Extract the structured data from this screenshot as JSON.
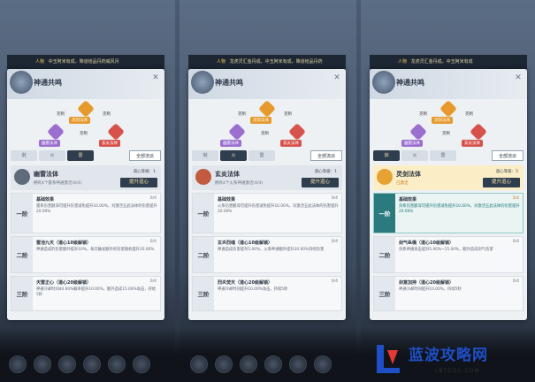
{
  "panels": [
    {
      "top_notice": {
        "tag": "人物",
        "text": "中玉阿米有成，降道结品丹药威风月"
      },
      "title": "神通共鸣",
      "triangle": {
        "top": "灵剑法体",
        "left": "幽雷法体",
        "right": "玄炎法体",
        "rel_left": "克制",
        "rel_right": "克制",
        "rel_bottom": "克制"
      },
      "tabs": [
        "剑",
        "火",
        "雷"
      ],
      "active_tab": 2,
      "all_button": "全部流派",
      "selected": {
        "name": "幽雷法体",
        "sub": "拥有4个雷系神通激活(4/4)",
        "level_label": "道心等级：1",
        "promote": "提升道心"
      },
      "tiers": [
        {
          "badge": "一阶",
          "title": "基础效果",
          "count": "0/4",
          "active": false,
          "desc": "雷系伤害额深可提升伤害减免提升10.00%，对激活五此法体的伤害提升20.00%"
        },
        {
          "badge": "二阶",
          "title": "雷池九天（道心10级解锁）",
          "count": "0/4",
          "active": false,
          "desc": "神通造成的伤害额外提升10%，每次触发额外的伤害随机提升20.00%"
        },
        {
          "badge": "三阶",
          "title": "天雷正心（道心20级解锁）",
          "count": "0/4",
          "active": false,
          "desc": "神通冷却时间40.00%概率提升10.00%，额外造成15.00%攻击，持续5秒"
        }
      ]
    },
    {
      "top_notice": {
        "tag": "人物",
        "text": "龙虎灵汇金丹成，中玉阿米有成，降道结品丹药"
      },
      "title": "神通共鸣",
      "triangle": {
        "top": "灵剑法体",
        "left": "幽雷法体",
        "right": "玄炎法体",
        "rel_left": "克制",
        "rel_right": "克制",
        "rel_bottom": "克制"
      },
      "tabs": [
        "剑",
        "火",
        "雷"
      ],
      "active_tab": 1,
      "all_button": "全部流派",
      "selected": {
        "name": "玄炎法体",
        "sub": "拥有4个火系神通激活(4/4)",
        "level_label": "道心等级：1",
        "promote": "提升道心"
      },
      "tiers": [
        {
          "badge": "一阶",
          "title": "基础效果",
          "count": "0/4",
          "active": false,
          "desc": "火系伤害额深可提升伤害减免提升10.00%，对激活五此法体的伤害提升20.00%"
        },
        {
          "badge": "二阶",
          "title": "玄炎烈魂（道心10级解锁）",
          "count": "0/4",
          "active": false,
          "desc": "神通造成伤害提升5.00%，火系神通额外提升20.00%持续伤害"
        },
        {
          "badge": "三阶",
          "title": "烈炎焚天（道心20级解锁）",
          "count": "0/4",
          "active": false,
          "desc": "神通冷却时间提升10.00%攻击，持续5秒"
        }
      ]
    },
    {
      "top_notice": {
        "tag": "人物",
        "text": "龙虎灵汇金丹成，中玉阿米有成"
      },
      "title": "神通共鸣",
      "triangle": {
        "top": "灵剑法体",
        "left": "幽雷法体",
        "right": "玄炎法体",
        "rel_left": "克制",
        "rel_right": "克制",
        "rel_bottom": "克制"
      },
      "tabs": [
        "剑",
        "火",
        "雷"
      ],
      "active_tab": 0,
      "all_button": "全部流派",
      "selected": {
        "name": "灵剑法体",
        "sub": "已激活",
        "level_label": "道心等级：5",
        "promote": "提升道心"
      },
      "tiers": [
        {
          "badge": "一阶",
          "title": "基础效果",
          "count": "5/4",
          "active": true,
          "desc": "剑系伤害额深可提升伤害减免提升10.00%，对激活五此法体的伤害提升20.00%"
        },
        {
          "badge": "二阶",
          "title": "剑气纵横（道心10级解锁）",
          "count": "0/4",
          "active": false,
          "desc": "剑系神通攻击提升5.00%~15.00%，额外造成剑气伤害"
        },
        {
          "badge": "三阶",
          "title": "剑意加持（道心20级解锁）",
          "count": "0/4",
          "active": false,
          "desc": "神通冷却时间提升10.00%，持续5秒"
        }
      ]
    }
  ],
  "watermark": {
    "title": "蓝波攻略网",
    "sub": "LBTDOC.COM"
  }
}
